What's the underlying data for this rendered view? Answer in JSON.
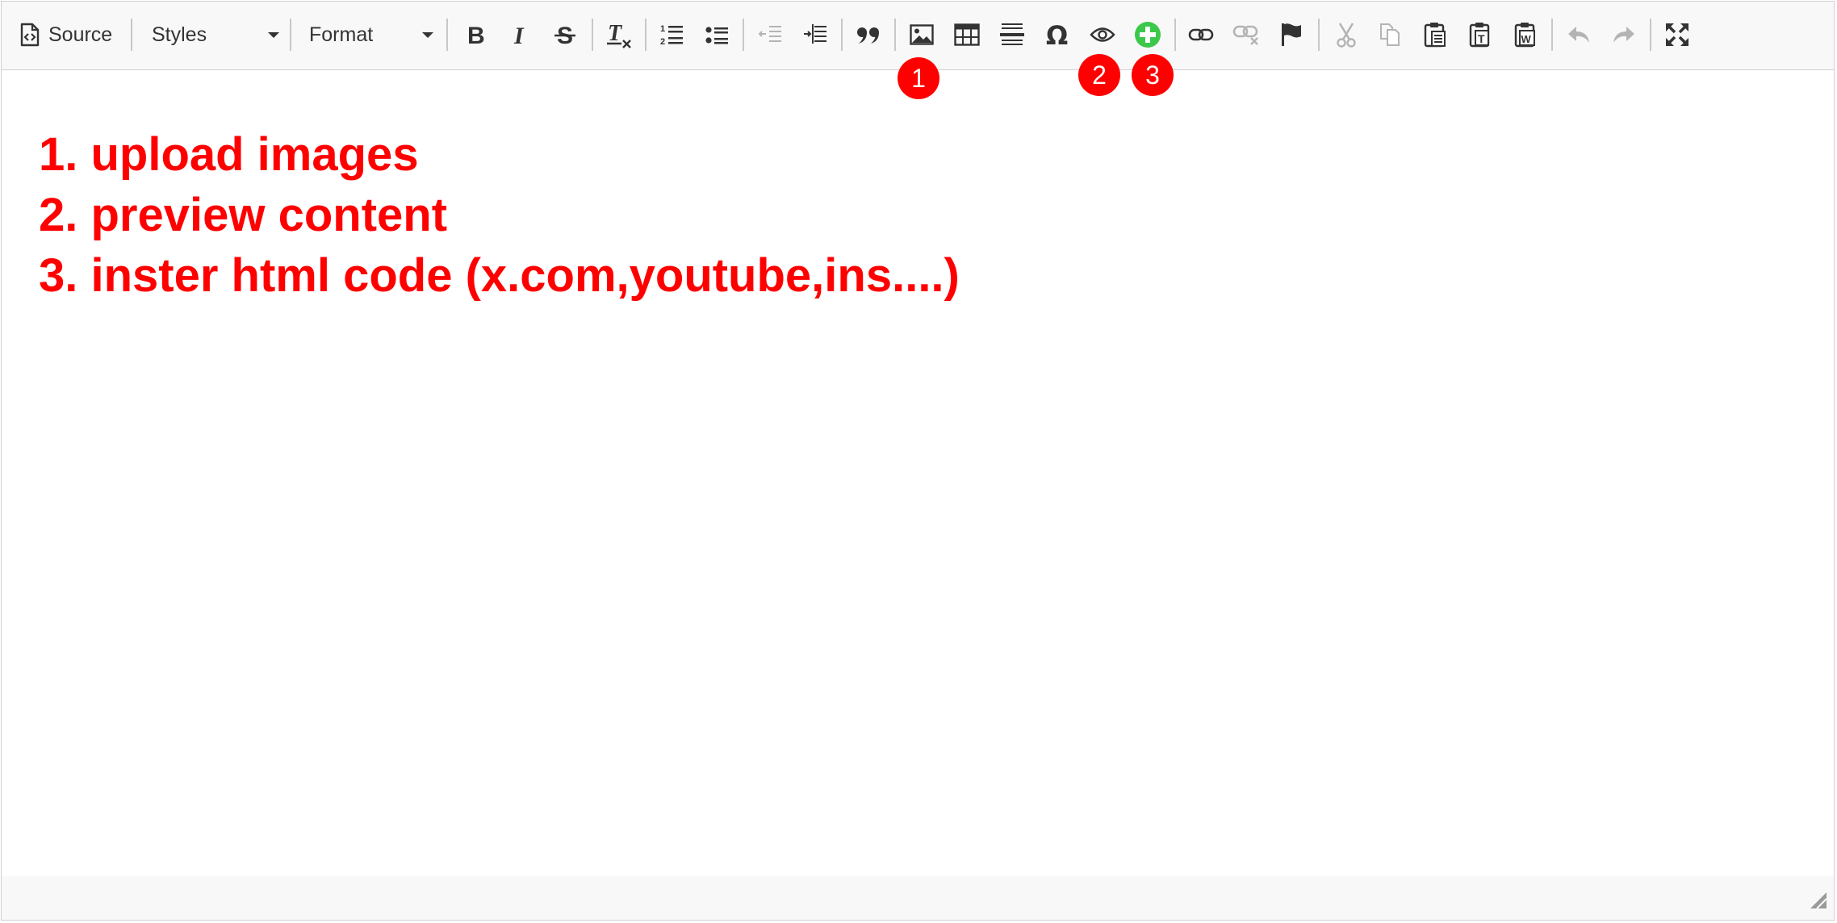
{
  "toolbar": {
    "source_label": "Source",
    "styles_label": "Styles",
    "format_label": "Format"
  },
  "content": {
    "lines": [
      "1. upload images",
      "2. preview content",
      "3. inster html code (x.com,youtube,ins....)"
    ]
  },
  "annotations": {
    "badge_1": "1",
    "badge_2": "2",
    "badge_3": "3"
  },
  "colors": {
    "annotation_red": "#ff0000",
    "add_icon_green": "#3cc84a",
    "icon_dark": "#333333",
    "icon_disabled": "#b4b4b4"
  }
}
